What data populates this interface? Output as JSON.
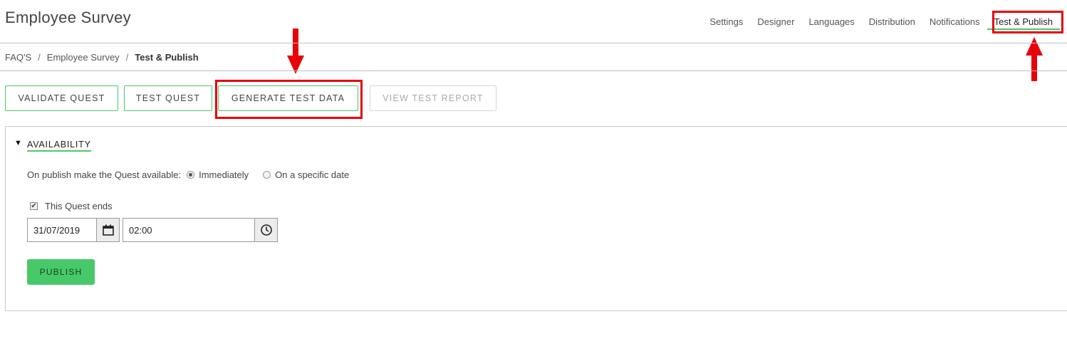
{
  "header": {
    "title": "Employee Survey",
    "nav": [
      "Settings",
      "Designer",
      "Languages",
      "Distribution",
      "Notifications",
      "Test & Publish"
    ],
    "active_nav": "Test & Publish"
  },
  "breadcrumb": {
    "items": [
      "FAQ'S",
      "Employee Survey"
    ],
    "current": "Test & Publish",
    "separator": "/"
  },
  "toolbar": {
    "validate": "VALIDATE QUEST",
    "test": "TEST QUEST",
    "generate": "GENERATE TEST DATA",
    "view_report": "VIEW TEST REPORT"
  },
  "availability": {
    "section_title": "AVAILABILITY",
    "publish_label": "On publish make the Quest available:",
    "option_immediately": "Immediately",
    "option_specific": "On a specific date",
    "selected": "Immediately",
    "ends_label": "This Quest ends",
    "ends_checked": true,
    "end_date": "31/07/2019",
    "end_time": "02:00",
    "publish_button": "PUBLISH"
  },
  "colors": {
    "accent": "#47c96a",
    "annotation": "#e8000a"
  },
  "icons": {
    "toggle": "caret-down-icon",
    "date": "calendar-icon",
    "time": "clock-icon"
  }
}
